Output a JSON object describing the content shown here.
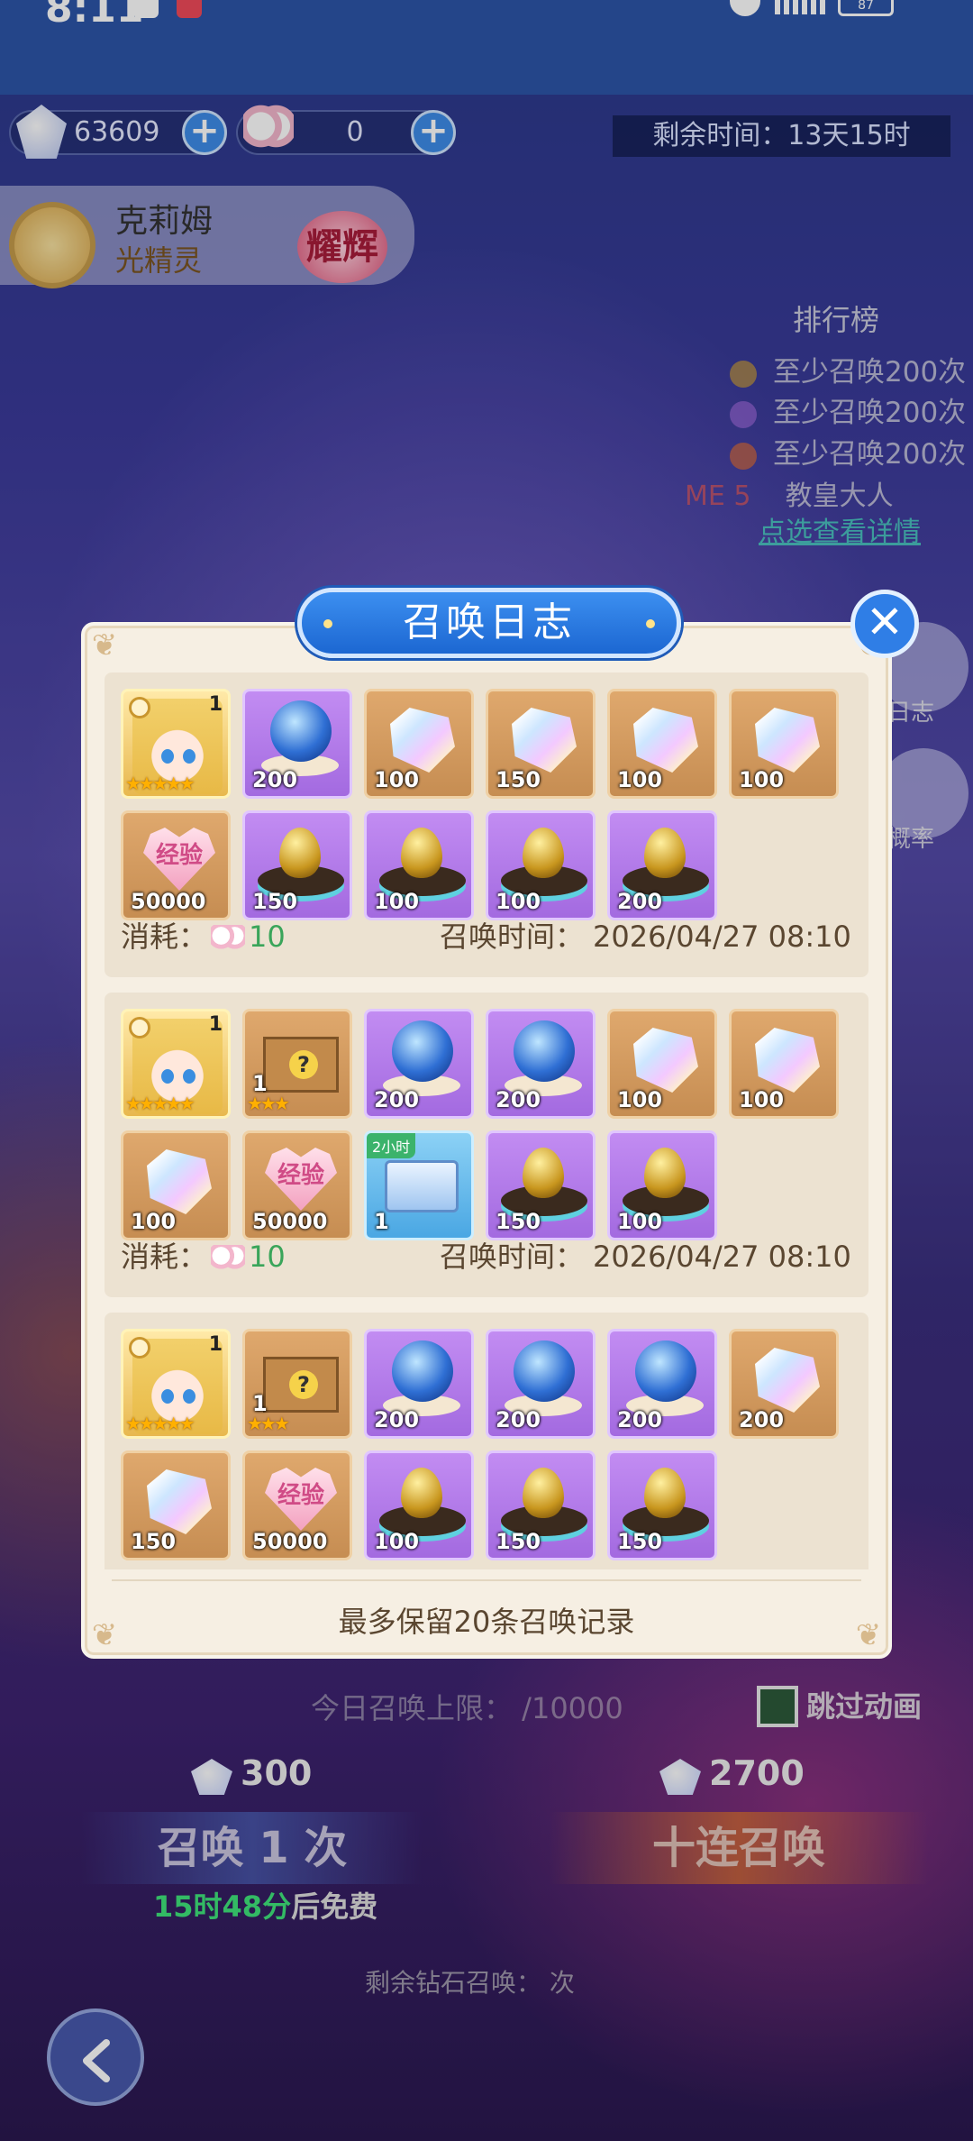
{
  "status_bar": {
    "time": "8:11",
    "battery": "87"
  },
  "currencies": [
    {
      "icon": "diamond-icon",
      "value": "63609"
    },
    {
      "icon": "tulip-icon",
      "value": "0"
    }
  ],
  "event": {
    "remaining": "剩余时间：13天15时"
  },
  "hero": {
    "name": "克莉姆",
    "subtitle": "光精灵",
    "badge": "耀辉"
  },
  "ranking": {
    "title": "排行榜",
    "rows": [
      "至少召唤200次",
      "至少召唤200次",
      "至少召唤200次"
    ],
    "me_label": "ME 5",
    "me_name": "教皇大人",
    "link": "点选查看详情"
  },
  "side_buttons": {
    "log": "日志",
    "prob": "概率"
  },
  "modal": {
    "title": "召唤日志",
    "footer": "最多保留20条召唤记录",
    "cost_label": "消耗：",
    "time_label": "召唤时间：",
    "records": [
      {
        "cost": "10",
        "time": "2026/04/27 08:10",
        "items": [
          {
            "kind": "hero",
            "count": "1",
            "stars": "★★★★★"
          },
          {
            "kind": "orb",
            "count": "200"
          },
          {
            "kind": "gem",
            "count": "100"
          },
          {
            "kind": "gem",
            "count": "150"
          },
          {
            "kind": "gem",
            "count": "100"
          },
          {
            "kind": "gem",
            "count": "100"
          },
          {
            "kind": "exp",
            "count": "50000",
            "label": "经验"
          },
          {
            "kind": "egg",
            "count": "150"
          },
          {
            "kind": "egg",
            "count": "100"
          },
          {
            "kind": "egg",
            "count": "100"
          },
          {
            "kind": "egg",
            "count": "200"
          }
        ]
      },
      {
        "cost": "10",
        "time": "2026/04/27 08:10",
        "items": [
          {
            "kind": "hero",
            "count": "1",
            "stars": "★★★★★"
          },
          {
            "kind": "box",
            "count": "1",
            "stars": "★★★"
          },
          {
            "kind": "orb",
            "count": "200"
          },
          {
            "kind": "orb",
            "count": "200"
          },
          {
            "kind": "gem",
            "count": "100"
          },
          {
            "kind": "gem",
            "count": "100"
          },
          {
            "kind": "gem",
            "count": "100"
          },
          {
            "kind": "exp",
            "count": "50000",
            "label": "经验"
          },
          {
            "kind": "chest",
            "count": "1",
            "tag": "2小时"
          },
          {
            "kind": "egg",
            "count": "150"
          },
          {
            "kind": "egg",
            "count": "100"
          }
        ]
      },
      {
        "cost": "",
        "time": "",
        "items": [
          {
            "kind": "hero",
            "count": "1",
            "stars": "★★★★★"
          },
          {
            "kind": "box",
            "count": "1",
            "stars": "★★★"
          },
          {
            "kind": "orb",
            "count": "200"
          },
          {
            "kind": "orb",
            "count": "200"
          },
          {
            "kind": "orb",
            "count": "200"
          },
          {
            "kind": "gem",
            "count": "200"
          },
          {
            "kind": "gem",
            "count": "150"
          },
          {
            "kind": "exp",
            "count": "50000",
            "label": "经验"
          },
          {
            "kind": "egg",
            "count": "100"
          },
          {
            "kind": "egg",
            "count": "150"
          },
          {
            "kind": "egg",
            "count": "150"
          }
        ]
      }
    ]
  },
  "summon": {
    "limit": "今日召唤上限：  /10000",
    "skip": "跳过动画",
    "cost_one": "300",
    "cost_ten": "2700",
    "one_label": "召唤 1 次",
    "ten_label": "十连召唤",
    "free_time": "15时48分",
    "free_suffix": "后免费",
    "diamond_left": "剩余钻石召唤：  次"
  }
}
